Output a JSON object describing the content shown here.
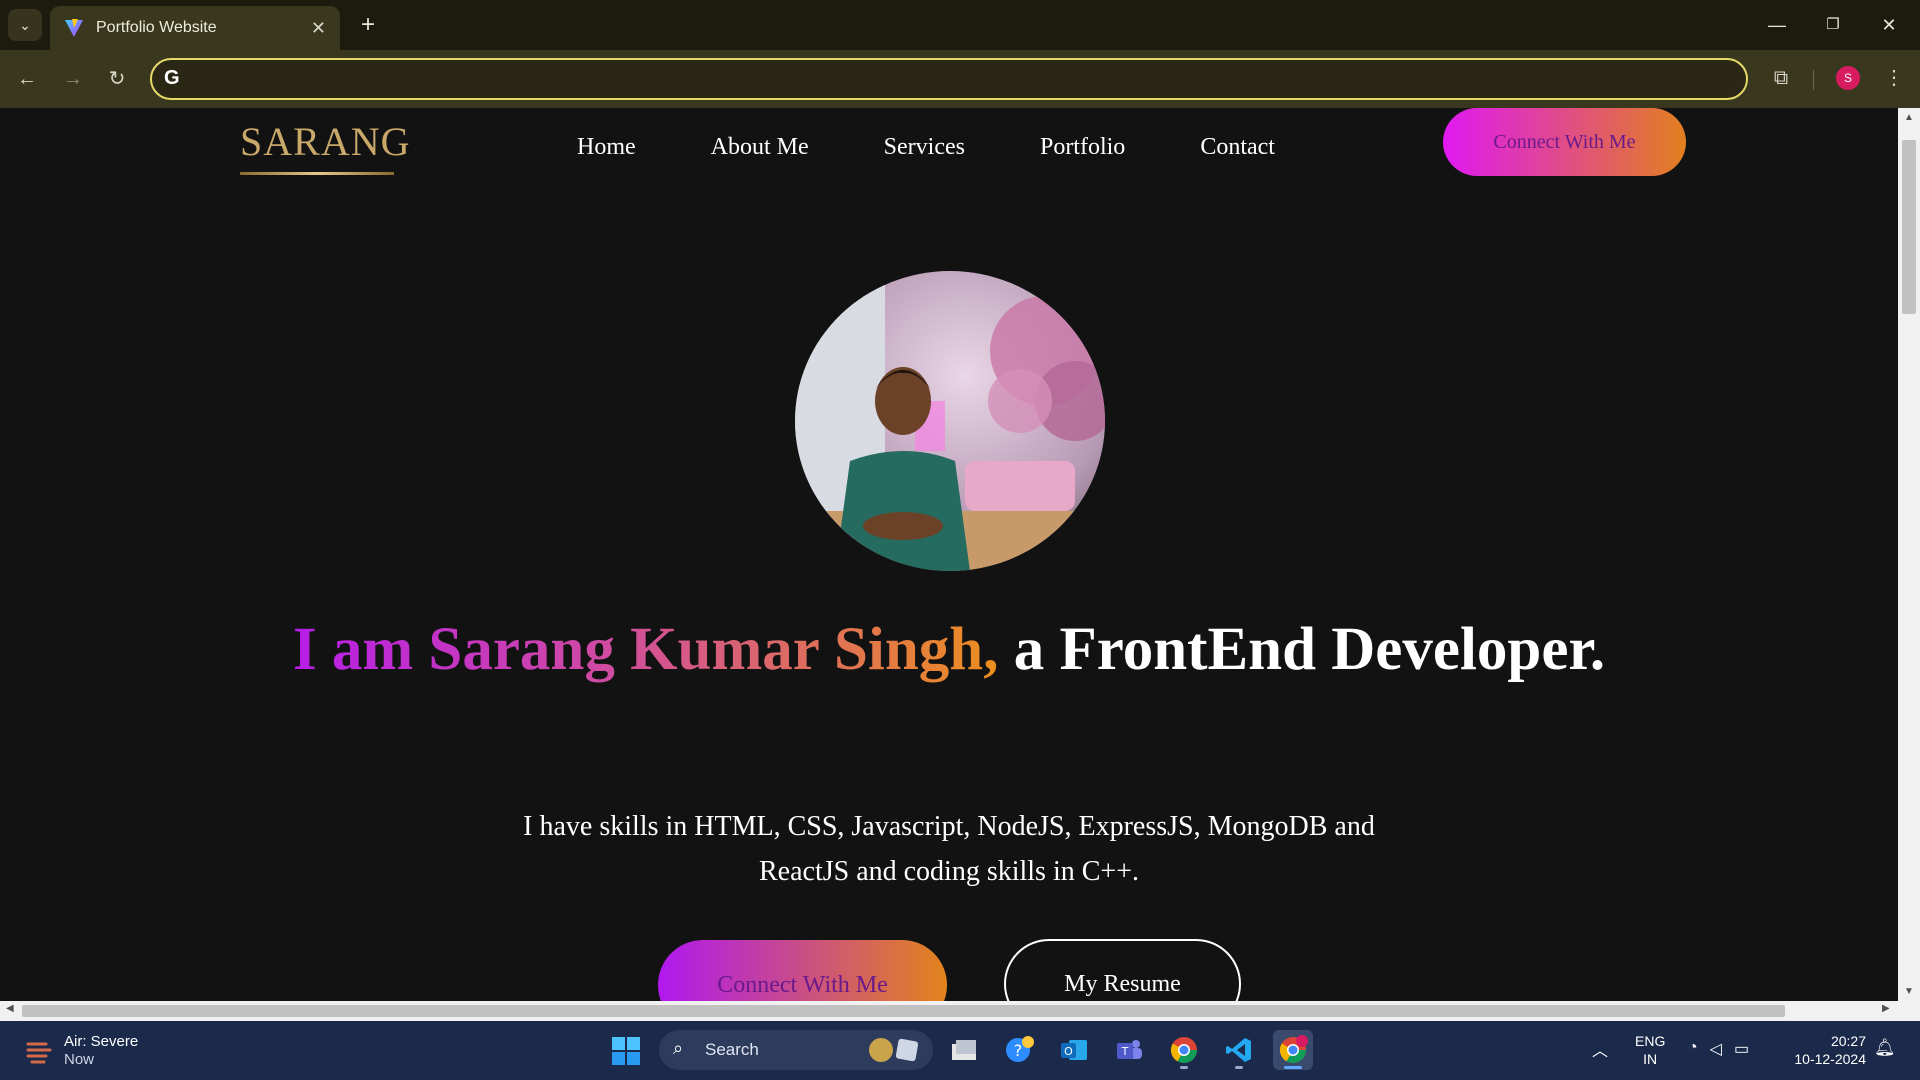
{
  "browser": {
    "tab_title": "Portfolio Website",
    "tab_close": "✕",
    "new_tab": "+",
    "omnibox_value": "",
    "profile_initial": "S",
    "window_controls": {
      "minimize": "—",
      "restore": "❐",
      "close": "✕"
    }
  },
  "site": {
    "logo_text": "SARANG",
    "nav": [
      "Home",
      "About Me",
      "Services",
      "Portfolio",
      "Contact"
    ],
    "connect_top": "Connect With Me",
    "headline_gradient": "I am Sarang Kumar Singh,",
    "headline_rest": " a FrontEnd Developer.",
    "description": "I have skills in HTML, CSS, Javascript, NodeJS, ExpressJS, MongoDB and ReactJS and coding skills in C++.",
    "btn_connect": "Connect With Me",
    "btn_resume": "My Resume",
    "colors": {
      "gradient_start": "#b71de8",
      "gradient_end": "#ec8e1e",
      "background": "#121212"
    }
  },
  "taskbar": {
    "weather_title": "Air: Severe",
    "weather_sub": "Now",
    "search_label": "Search",
    "lang_line1": "ENG",
    "lang_line2": "IN",
    "time": "20:27",
    "date": "10-12-2024",
    "apps": [
      "file-explorer-icon",
      "help-icon",
      "outlook-icon",
      "teams-icon",
      "chrome-icon",
      "vscode-icon",
      "chrome-profile-icon"
    ]
  }
}
